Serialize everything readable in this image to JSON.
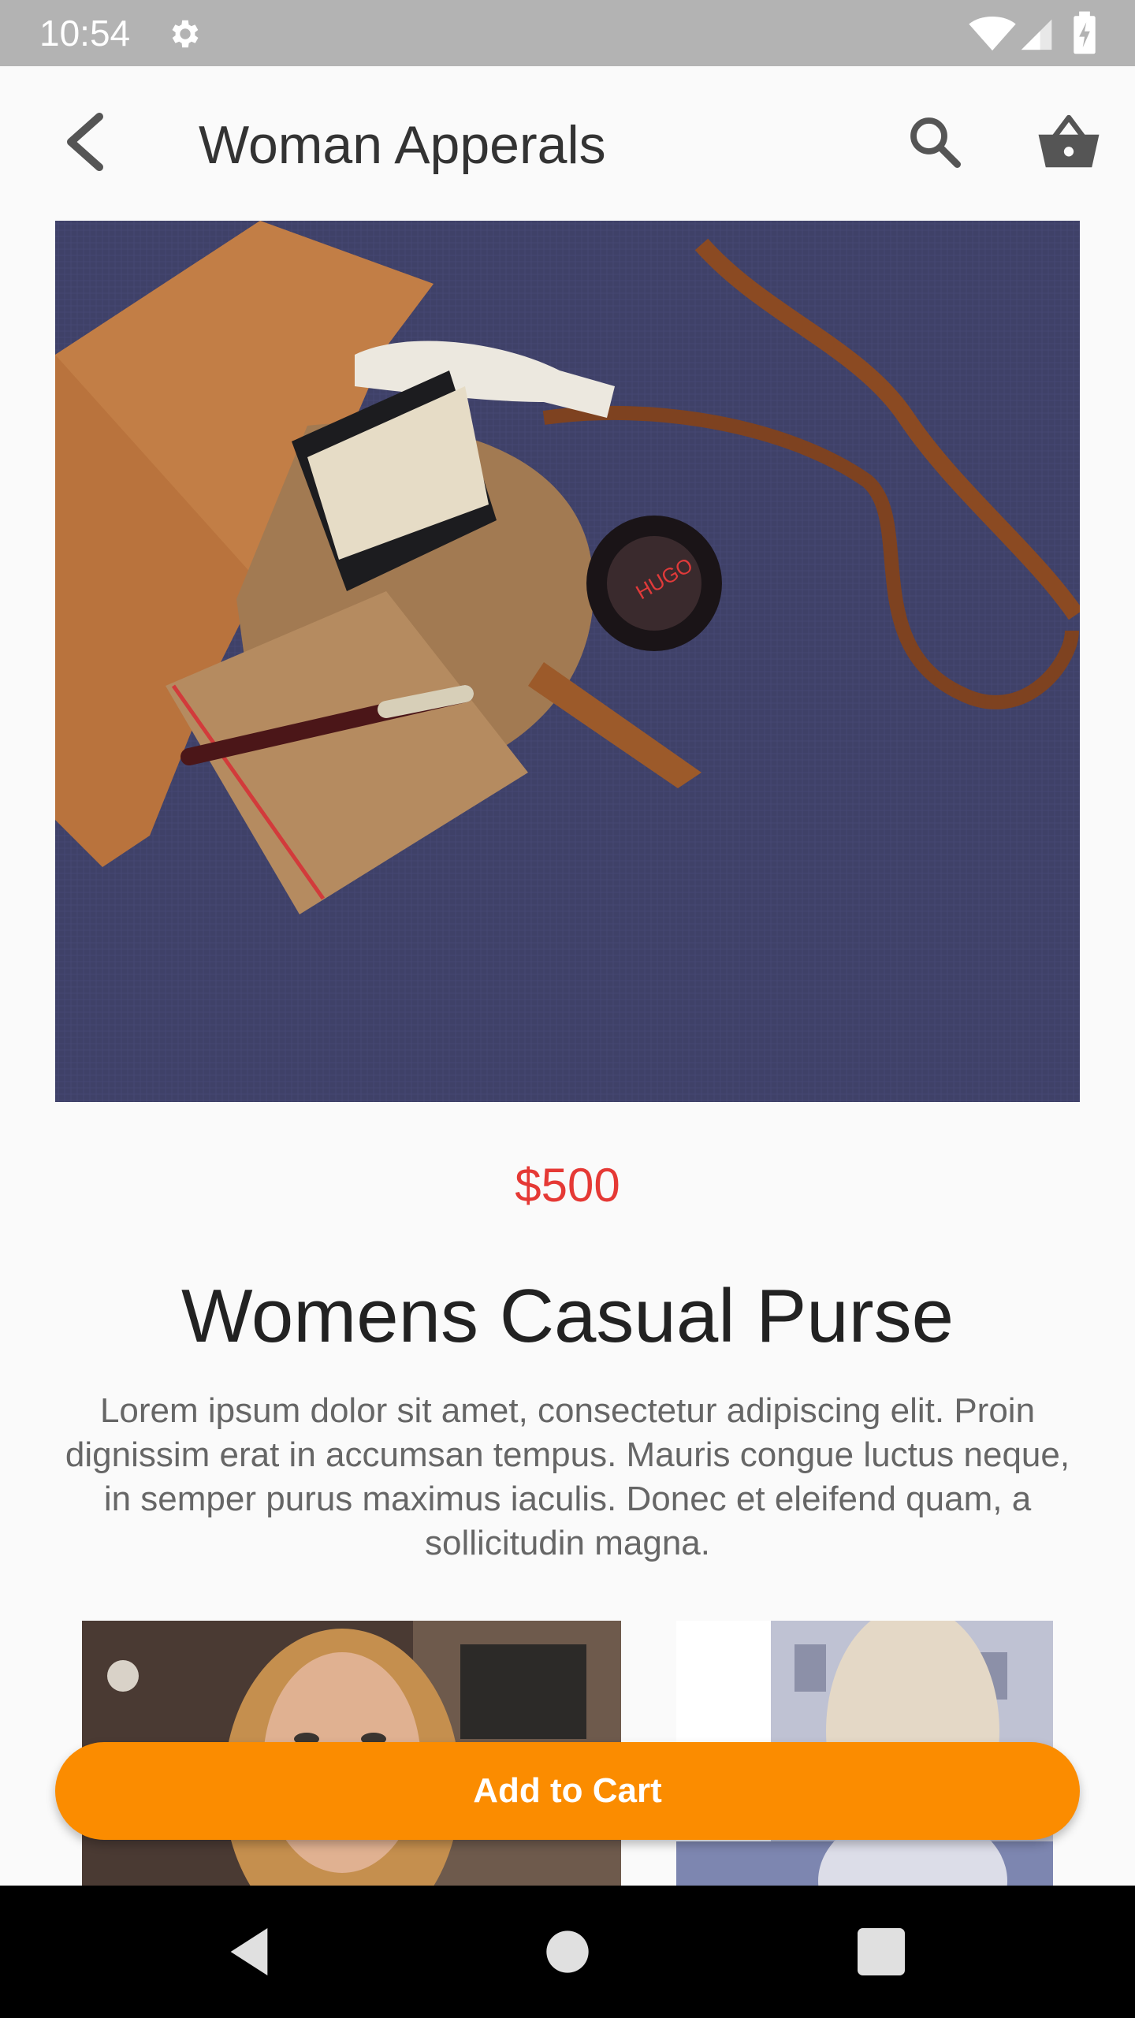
{
  "status_bar": {
    "time": "10:54",
    "icons": [
      "gear-icon",
      "wifi-icon",
      "signal-icon",
      "battery-icon"
    ]
  },
  "app_bar": {
    "title": "Woman Apperals",
    "icons": [
      "back-arrow-icon",
      "search-icon",
      "shopping-basket-icon"
    ]
  },
  "product": {
    "image": "open-leather-bag-with-accessories-photo",
    "image_text": "HUGO",
    "price": "$500",
    "title": "Womens Casual Purse",
    "description": "Lorem ipsum dolor sit amet, consectetur adipiscing elit. Proin dignissim erat in accumsan tempus. Mauris congue luctus neque, in semper purus maximus iaculis. Donec et eleifend quam, a sollicitudin magna."
  },
  "gallery": [
    {
      "image": "woman-portrait-photo"
    },
    {
      "image": "woman-street-photo"
    }
  ],
  "actions": {
    "add_to_cart": "Add to Cart"
  },
  "colors": {
    "price": "#e53935",
    "accent": "#fb8c00",
    "status_bar": "#b3b3b3",
    "nav_bar": "#000000"
  }
}
